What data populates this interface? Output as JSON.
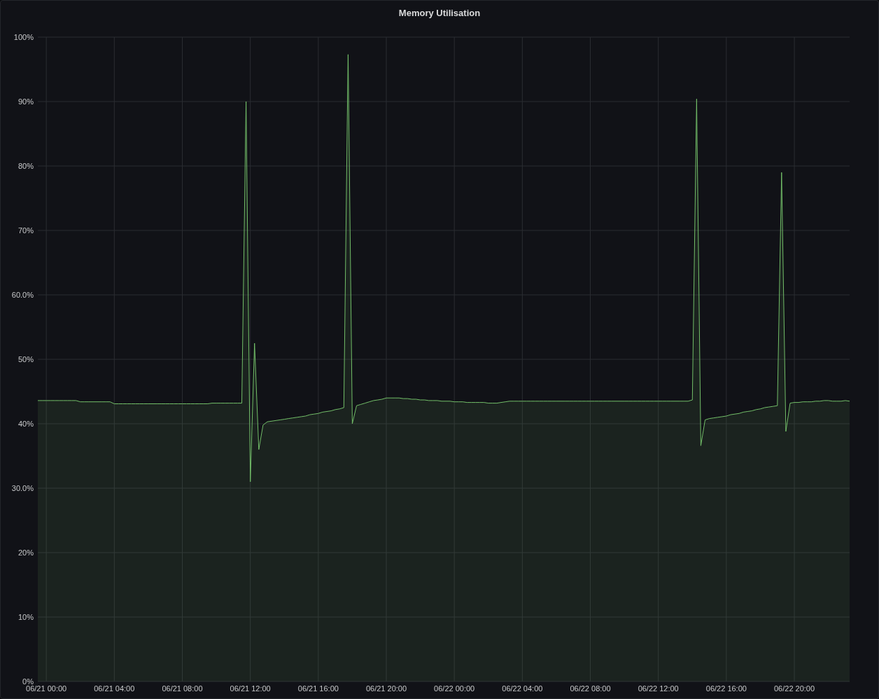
{
  "panel": {
    "chart_data": {
      "type": "area",
      "title": "Memory Utilisation",
      "grid": true,
      "categories": [
        null,
        null,
        "06/21 00:00",
        null,
        null,
        null,
        null,
        null,
        null,
        null,
        null,
        null,
        null,
        null,
        null,
        null,
        null,
        null,
        "06/21 04:00",
        null,
        null,
        null,
        null,
        null,
        null,
        null,
        null,
        null,
        null,
        null,
        null,
        null,
        null,
        null,
        "06/21 08:00",
        null,
        null,
        null,
        null,
        null,
        null,
        null,
        null,
        null,
        null,
        null,
        null,
        null,
        null,
        null,
        "06/21 12:00",
        null,
        null,
        null,
        null,
        null,
        null,
        null,
        null,
        null,
        null,
        null,
        null,
        null,
        null,
        null,
        "06/21 16:00",
        null,
        null,
        null,
        null,
        null,
        null,
        null,
        null,
        null,
        null,
        null,
        null,
        null,
        null,
        null,
        "06/21 20:00",
        null,
        null,
        null,
        null,
        null,
        null,
        null,
        null,
        null,
        null,
        null,
        null,
        null,
        null,
        null,
        "06/22 00:00",
        null,
        null,
        null,
        null,
        null,
        null,
        null,
        null,
        null,
        null,
        null,
        null,
        null,
        null,
        null,
        "06/22 04:00",
        null,
        null,
        null,
        null,
        null,
        null,
        null,
        null,
        null,
        null,
        null,
        null,
        null,
        null,
        null,
        "06/22 08:00",
        null,
        null,
        null,
        null,
        null,
        null,
        null,
        null,
        null,
        null,
        null,
        null,
        null,
        null,
        null,
        "06/22 12:00",
        null,
        null,
        null,
        null,
        null,
        null,
        null,
        null,
        null,
        null,
        null,
        null,
        null,
        null,
        null,
        "06/22 16:00",
        null,
        null,
        null,
        null,
        null,
        null,
        null,
        null,
        null,
        null,
        null,
        null,
        null,
        null,
        null,
        "06/22 20:00",
        null,
        null,
        null,
        null,
        null,
        null,
        null,
        null,
        null,
        null,
        null,
        null,
        null
      ],
      "series": [
        {
          "color": "#73bf69",
          "values": [
            43.6,
            43.6,
            43.6,
            43.6,
            43.6,
            43.6,
            43.6,
            43.6,
            43.6,
            43.6,
            43.4,
            43.4,
            43.4,
            43.4,
            43.4,
            43.4,
            43.4,
            43.4,
            43.1,
            43.1,
            43.1,
            43.1,
            43.1,
            43.1,
            43.1,
            43.1,
            43.1,
            43.1,
            43.1,
            43.1,
            43.1,
            43.1,
            43.1,
            43.1,
            43.1,
            43.1,
            43.1,
            43.1,
            43.1,
            43.1,
            43.1,
            43.2,
            43.2,
            43.2,
            43.2,
            43.2,
            43.2,
            43.2,
            43.2,
            90,
            31,
            52.5,
            36,
            39.8,
            40.3,
            40.4,
            40.5,
            40.6,
            40.7,
            40.8,
            40.9,
            41.0,
            41.1,
            41.2,
            41.4,
            41.5,
            41.6,
            41.8,
            41.9,
            42.0,
            42.2,
            42.3,
            42.5,
            97.3,
            40,
            42.8,
            43.0,
            43.2,
            43.4,
            43.6,
            43.7,
            43.8,
            44.0,
            44.0,
            44.0,
            44.0,
            43.9,
            43.9,
            43.8,
            43.8,
            43.7,
            43.7,
            43.6,
            43.6,
            43.6,
            43.5,
            43.5,
            43.5,
            43.4,
            43.4,
            43.4,
            43.3,
            43.3,
            43.3,
            43.3,
            43.3,
            43.2,
            43.2,
            43.2,
            43.3,
            43.4,
            43.5,
            43.5,
            43.5,
            43.5,
            43.5,
            43.5,
            43.5,
            43.5,
            43.5,
            43.5,
            43.5,
            43.5,
            43.5,
            43.5,
            43.5,
            43.5,
            43.5,
            43.5,
            43.5,
            43.5,
            43.5,
            43.5,
            43.5,
            43.5,
            43.5,
            43.5,
            43.5,
            43.5,
            43.5,
            43.5,
            43.5,
            43.5,
            43.5,
            43.5,
            43.5,
            43.5,
            43.5,
            43.5,
            43.5,
            43.5,
            43.5,
            43.5,
            43.5,
            43.7,
            90.4,
            36.6,
            40.6,
            40.8,
            40.9,
            41.0,
            41.1,
            41.2,
            41.4,
            41.5,
            41.6,
            41.8,
            41.9,
            42.0,
            42.2,
            42.3,
            42.5,
            42.6,
            42.7,
            42.8,
            79,
            38.8,
            43.2,
            43.3,
            43.3,
            43.4,
            43.4,
            43.4,
            43.5,
            43.5,
            43.6,
            43.6,
            43.5,
            43.5,
            43.5,
            43.6,
            43.5
          ]
        }
      ],
      "ylim": [
        0,
        100
      ],
      "yticks": [
        {
          "value": 0,
          "label": "0%"
        },
        {
          "value": 10,
          "label": "10%"
        },
        {
          "value": 20,
          "label": "20%"
        },
        {
          "value": 30,
          "label": "30.0%"
        },
        {
          "value": 40,
          "label": "40%"
        },
        {
          "value": 50,
          "label": "50%"
        },
        {
          "value": 60,
          "label": "60.0%"
        },
        {
          "value": 70,
          "label": "70%"
        },
        {
          "value": 80,
          "label": "80%"
        },
        {
          "value": 90,
          "label": "90%"
        },
        {
          "value": 100,
          "label": "100%"
        }
      ]
    }
  }
}
